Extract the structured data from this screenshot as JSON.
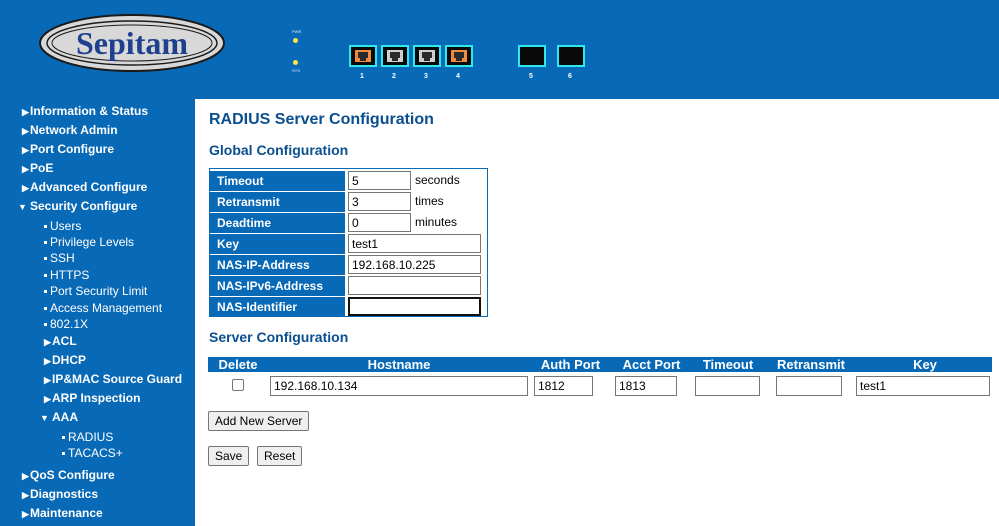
{
  "header": {
    "logo_text": "Sepitam",
    "led_labels": [
      "PWR",
      "SYS"
    ],
    "ports": [
      "1",
      "2",
      "3",
      "4",
      "5",
      "6"
    ],
    "colors": {
      "bar": "#0869b7",
      "port_border": "#2de8f0",
      "port_active": "#f08a3c"
    }
  },
  "sidebar": {
    "items": [
      {
        "label": "Information & Status",
        "arrow": "right"
      },
      {
        "label": "Network Admin",
        "arrow": "right"
      },
      {
        "label": "Port Configure",
        "arrow": "right"
      },
      {
        "label": "PoE",
        "arrow": "right"
      },
      {
        "label": "Advanced Configure",
        "arrow": "right"
      },
      {
        "label": "Security Configure",
        "arrow": "down"
      }
    ],
    "security_subitems": [
      "Users",
      "Privilege Levels",
      "SSH",
      "HTTPS",
      "Port Security Limit",
      "Access Management",
      "802.1X"
    ],
    "security_groups": [
      "ACL",
      "DHCP",
      "IP&MAC Source Guard",
      "ARP Inspection"
    ],
    "aaa": {
      "label": "AAA",
      "subitems": [
        "RADIUS",
        "TACACS+"
      ]
    },
    "bottom_items": [
      "QoS Configure",
      "Diagnostics",
      "Maintenance"
    ]
  },
  "main": {
    "title": "RADIUS Server Configuration",
    "global_title": "Global Configuration",
    "global": {
      "timeout": {
        "label": "Timeout",
        "value": "5",
        "unit": "seconds"
      },
      "retransmit": {
        "label": "Retransmit",
        "value": "3",
        "unit": "times"
      },
      "deadtime": {
        "label": "Deadtime",
        "value": "0",
        "unit": "minutes"
      },
      "key": {
        "label": "Key",
        "value": "test1"
      },
      "nas_ip": {
        "label": "NAS-IP-Address",
        "value": "192.168.10.225"
      },
      "nas_ipv6": {
        "label": "NAS-IPv6-Address",
        "value": ""
      },
      "nas_id": {
        "label": "NAS-Identifier",
        "value": ""
      }
    },
    "server_title": "Server Configuration",
    "server_table": {
      "headers": [
        "Delete",
        "Hostname",
        "Auth Port",
        "Acct Port",
        "Timeout",
        "Retransmit",
        "Key"
      ],
      "row": {
        "delete_checked": false,
        "hostname": "192.168.10.134",
        "auth_port": "1812",
        "acct_port": "1813",
        "timeout": "",
        "retransmit": "",
        "key": "test1"
      }
    },
    "buttons": {
      "add_new_server": "Add New Server",
      "save": "Save",
      "reset": "Reset"
    }
  }
}
